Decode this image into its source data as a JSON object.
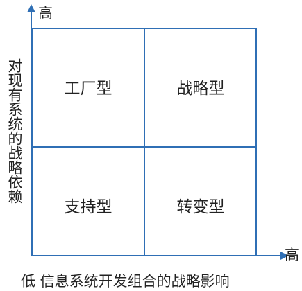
{
  "axes": {
    "y_high_label": "高",
    "x_high_label": "高",
    "y_title": "对现有系统的战略依赖",
    "x_title": "低 信息系统开发组合的战略影响"
  },
  "quadrants": {
    "top_left": "工厂型",
    "top_right": "战略型",
    "bottom_left": "支持型",
    "bottom_right": "转变型"
  },
  "colors": {
    "line": "#2f6fb5",
    "text": "#222222"
  }
}
